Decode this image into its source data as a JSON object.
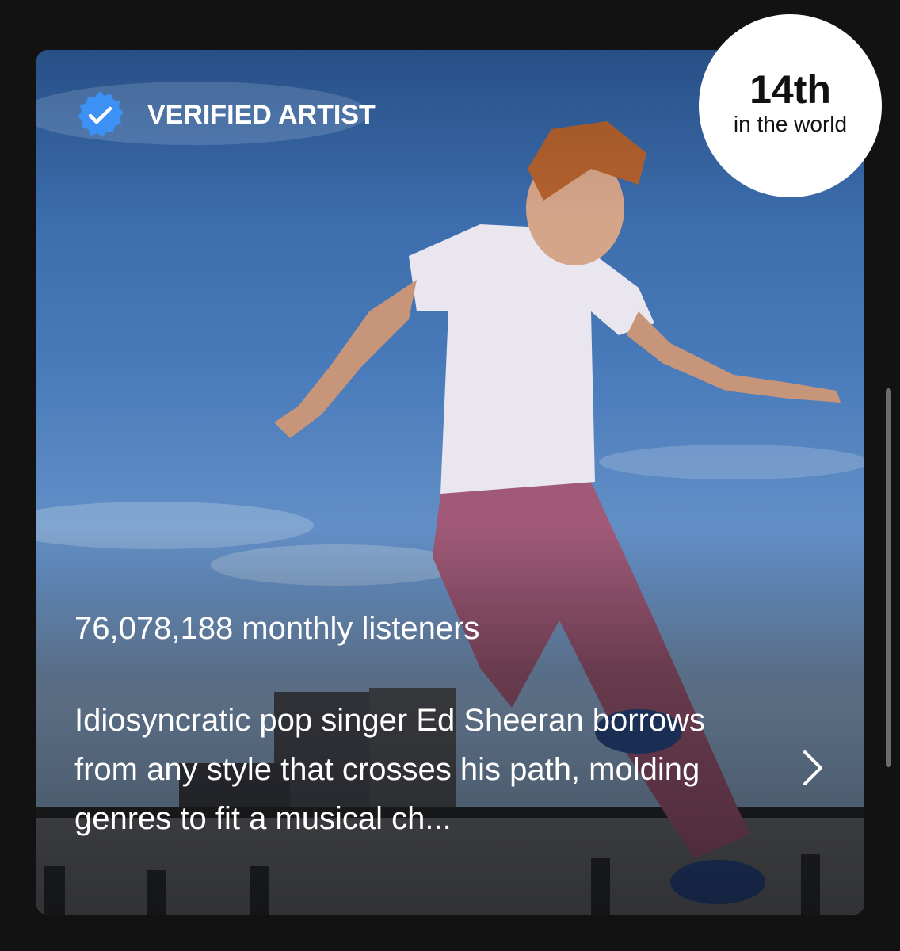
{
  "artist_card": {
    "verified_label": "VERIFIED ARTIST",
    "monthly_listeners": "76,078,188 monthly listeners",
    "bio": "Idiosyncratic pop singer Ed Sheeran borrows from any style that crosses his path, molding genres to fit a musical ch...",
    "rank": {
      "position": "14th",
      "subtitle": "in the world"
    },
    "icons": {
      "verified": "verified-badge-icon",
      "more": "chevron-right-icon"
    },
    "colors": {
      "verified_blue": "#3d91f4",
      "sky": "#4d7dbd",
      "page_background": "#121212",
      "badge_background": "#ffffff"
    }
  }
}
